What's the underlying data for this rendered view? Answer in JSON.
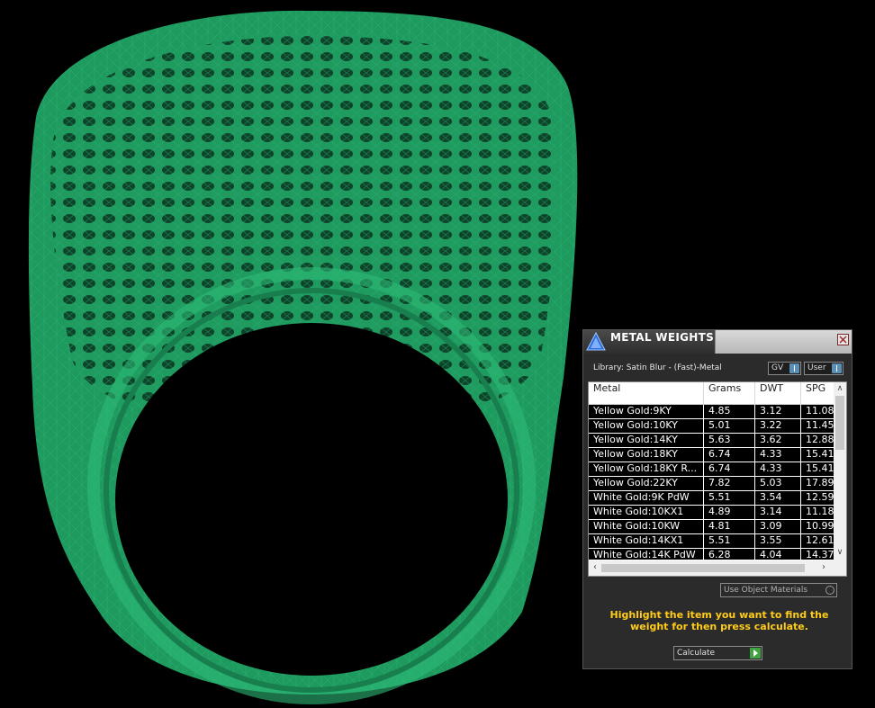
{
  "viewport": {
    "object": "ring-wireframe",
    "mesh_color": "#1e9a60",
    "background": "#000000"
  },
  "panel": {
    "title": "METAL WEIGHTS",
    "library_label": "Library: Satin Blur - (Fast)-Metal",
    "gv_select": "GV",
    "user_select": "User",
    "columns": [
      "Metal",
      "Grams",
      "DWT",
      "SPG"
    ],
    "rows": [
      {
        "metal": "Yellow Gold:9KY",
        "grams": "4.85",
        "dwt": "3.12",
        "spg": "11.08"
      },
      {
        "metal": "Yellow Gold:10KY",
        "grams": "5.01",
        "dwt": "3.22",
        "spg": "11.45"
      },
      {
        "metal": "Yellow Gold:14KY",
        "grams": "5.63",
        "dwt": "3.62",
        "spg": "12.88"
      },
      {
        "metal": "Yellow Gold:18KY",
        "grams": "6.74",
        "dwt": "4.33",
        "spg": "15.41"
      },
      {
        "metal": "Yellow Gold:18KY R...",
        "grams": "6.74",
        "dwt": "4.33",
        "spg": "15.41"
      },
      {
        "metal": "Yellow Gold:22KY",
        "grams": "7.82",
        "dwt": "5.03",
        "spg": "17.89"
      },
      {
        "metal": "White Gold:9K PdW",
        "grams": "5.51",
        "dwt": "3.54",
        "spg": "12.59"
      },
      {
        "metal": "White Gold:10KX1",
        "grams": "4.89",
        "dwt": "3.14",
        "spg": "11.18"
      },
      {
        "metal": "White Gold:10KW",
        "grams": "4.81",
        "dwt": "3.09",
        "spg": "10.99"
      },
      {
        "metal": "White Gold:14KX1",
        "grams": "5.51",
        "dwt": "3.55",
        "spg": "12.61"
      },
      {
        "metal": "White Gold:14K PdW",
        "grams": "6.28",
        "dwt": "4.04",
        "spg": "14.37"
      }
    ],
    "use_object_materials": "Use Object Materials",
    "hint": "Highlight the item you want to find the weight for then press calculate.",
    "calculate_label": "Calculate",
    "colors": {
      "hint": "#ffcc1a",
      "row_bg": "#000000",
      "accent_button": "#3fa33f"
    }
  }
}
